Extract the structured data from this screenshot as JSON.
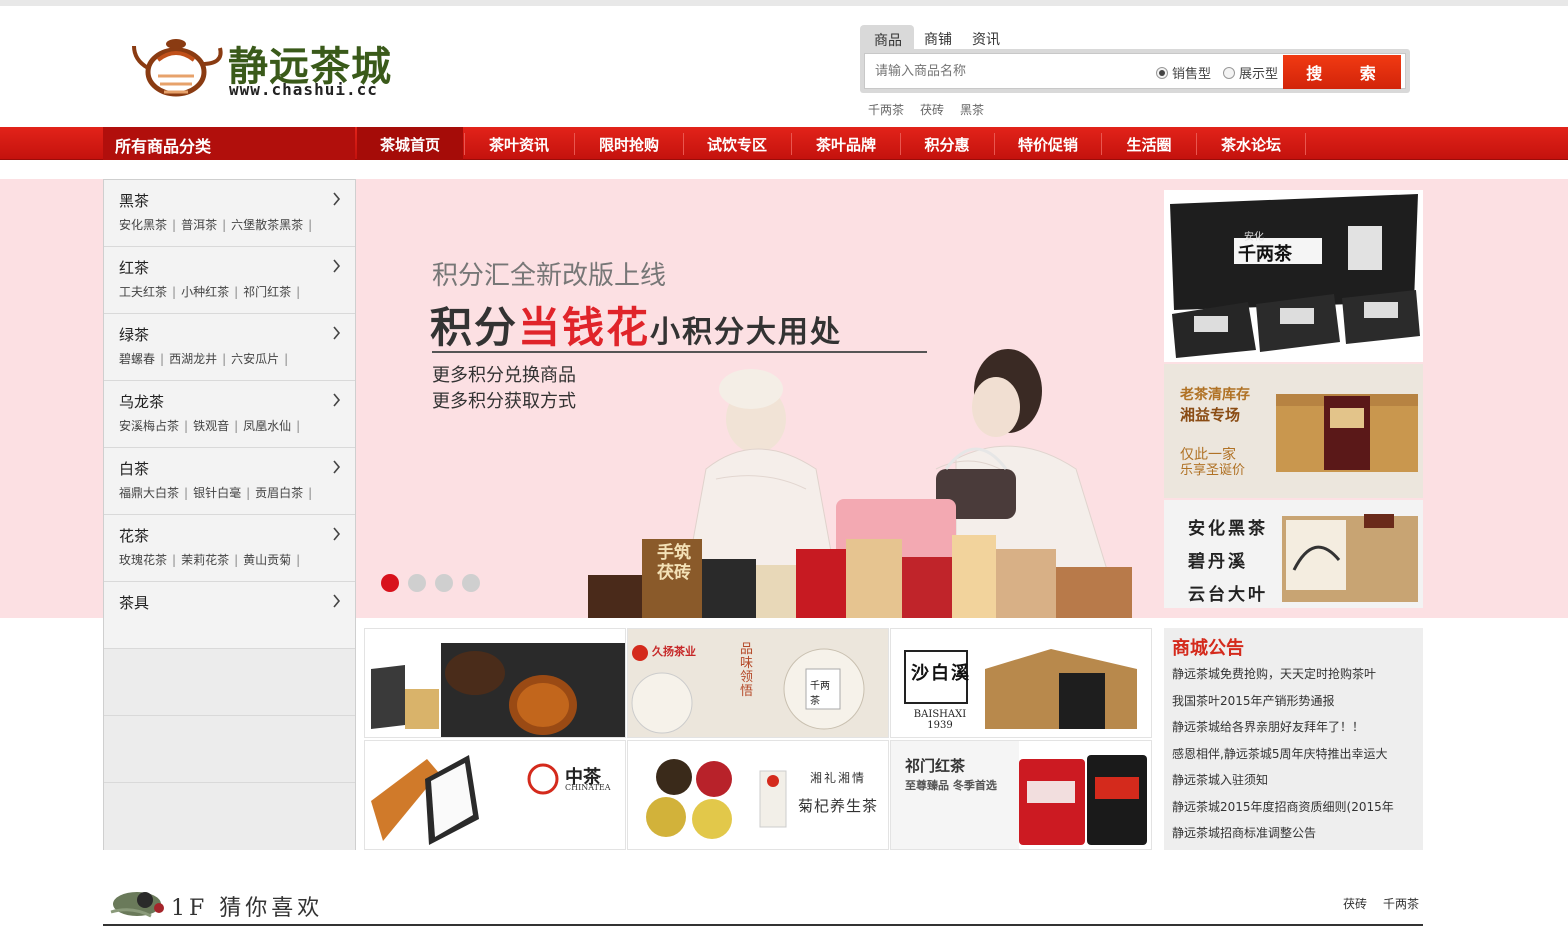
{
  "colors": {
    "brand_red": "#d42a1c",
    "nav_red": "#e2231a",
    "banner_bg": "#fce0e3",
    "logo_green": "#3a5a1a"
  },
  "logo": {
    "name": "静远茶城",
    "url": "www.chashui.cc"
  },
  "search": {
    "tabs": [
      "商品",
      "商铺",
      "资讯"
    ],
    "placeholder": "请输入商品名称",
    "radio_sale": "销售型",
    "radio_show": "展示型",
    "button": "搜 索",
    "hot_words": [
      "千两茶",
      "茯砖",
      "黑茶"
    ]
  },
  "nav": {
    "all_categories": "所有商品分类",
    "items": [
      "茶城首页",
      "茶叶资讯",
      "限时抢购",
      "试饮专区",
      "茶叶品牌",
      "积分惠",
      "特价促销",
      "生活圈",
      "茶水论坛"
    ]
  },
  "categories": [
    {
      "title": "黑茶",
      "subs": [
        "安化黑茶",
        "普洱茶",
        "六堡散茶黑茶"
      ]
    },
    {
      "title": "红茶",
      "subs": [
        "工夫红茶",
        "小种红茶",
        "祁门红茶"
      ]
    },
    {
      "title": "绿茶",
      "subs": [
        "碧螺春",
        "西湖龙井",
        "六安瓜片"
      ]
    },
    {
      "title": "乌龙茶",
      "subs": [
        "安溪梅占茶",
        "铁观音",
        "凤凰水仙"
      ]
    },
    {
      "title": "白茶",
      "subs": [
        "福鼎大白茶",
        "银针白毫",
        "贡眉白茶"
      ]
    },
    {
      "title": "花茶",
      "subs": [
        "玫瑰花茶",
        "茉莉花茶",
        "黄山贡菊"
      ]
    },
    {
      "title": "茶具",
      "subs": []
    }
  ],
  "banner": {
    "line1": "积分汇全新改版上线",
    "line2_a": "积分",
    "line2_b": "当钱花",
    "line2_c": "小积分大用处",
    "line3": "更多积分兑换商品",
    "line4": "更多积分获取方式",
    "product_label_1": "手筑茯砖",
    "slides": 4,
    "active_slide": 1
  },
  "promos": {
    "p1_label": "千两茶",
    "p1_sub": "安化",
    "p2": [
      "老茶清库存",
      "湘益专场",
      "仅此一家",
      "乐享圣诞价"
    ],
    "p3": [
      "安化黑茶",
      "碧丹溪",
      "云台大叶"
    ]
  },
  "tiles": {
    "t2_brand": "久扬茶业",
    "t2_text": "品味 领悟",
    "t2_label": "千两茶",
    "t3_brand": "沙白溪",
    "t3_year": "BAISHAXI 1939",
    "t4_brand": "中茶",
    "t4_sub": "CHINATEA",
    "t5_a": "湘礼湘情",
    "t5_b": "菊杞养生茶",
    "t6_a": "祁门红茶",
    "t6_b": "至尊臻品 冬季首选"
  },
  "notice": {
    "title": "商城公告",
    "items": [
      "静远茶城免费抢购，天天定时抢购茶叶",
      "我国茶叶2015年产销形势通报",
      "静远茶城给各界亲朋好友拜年了！！",
      "感恩相伴,静远茶城5周年庆特推出幸运大",
      "静远茶城入驻须知",
      "静远茶城2015年度招商资质细则(2015年",
      "静远茶城招商标准调整公告"
    ]
  },
  "floor": {
    "title": "1F 猜你喜欢",
    "links": [
      "茯砖",
      "千两茶"
    ]
  }
}
